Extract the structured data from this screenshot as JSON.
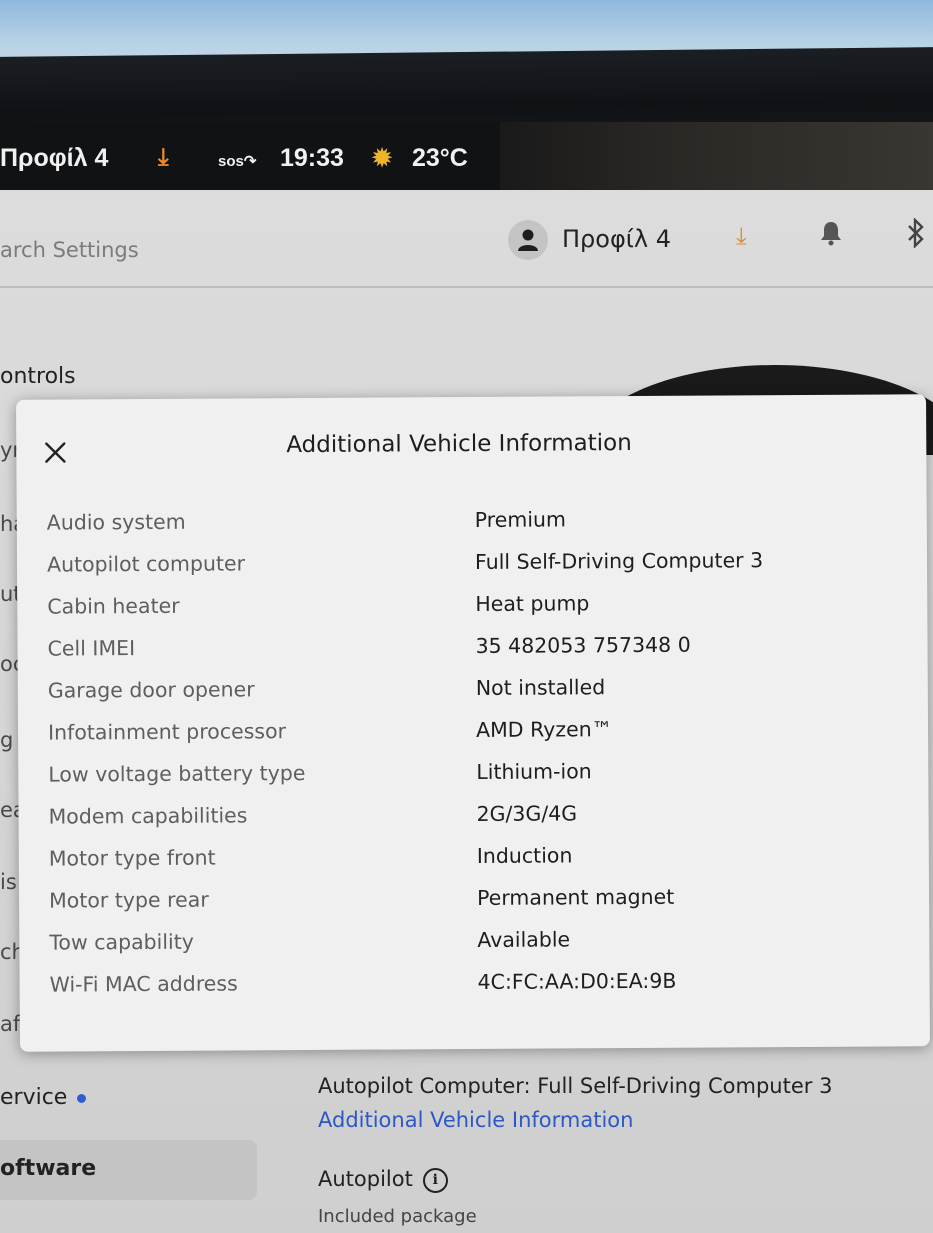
{
  "status_bar": {
    "profile": "Προφίλ 4",
    "sos": "sos",
    "time": "19:33",
    "temperature": "23°C"
  },
  "header": {
    "search_placeholder": "arch Settings",
    "profile_name": "Προφίλ 4"
  },
  "sidebar": {
    "items": [
      {
        "label": "ontrols"
      },
      {
        "label": "ervice"
      },
      {
        "label": "oftware"
      }
    ],
    "partial_labels": [
      "yr",
      "ha",
      "ut",
      "oc",
      "g",
      "ea",
      "is",
      "ch",
      "af"
    ]
  },
  "modal": {
    "title": "Additional Vehicle Information",
    "rows": [
      {
        "label": "Audio system",
        "value": "Premium"
      },
      {
        "label": "Autopilot computer",
        "value": "Full Self-Driving Computer 3"
      },
      {
        "label": "Cabin heater",
        "value": "Heat pump"
      },
      {
        "label": "Cell IMEI",
        "value": "35 482053 757348 0"
      },
      {
        "label": "Garage door opener",
        "value": "Not installed"
      },
      {
        "label": "Infotainment processor",
        "value": "AMD Ryzen™"
      },
      {
        "label": "Low voltage battery type",
        "value": "Lithium-ion"
      },
      {
        "label": "Modem capabilities",
        "value": "2G/3G/4G"
      },
      {
        "label": "Motor type front",
        "value": "Induction"
      },
      {
        "label": "Motor type rear",
        "value": "Permanent magnet"
      },
      {
        "label": "Tow capability",
        "value": "Available"
      },
      {
        "label": "Wi-Fi MAC address",
        "value": "4C:FC:AA:D0:EA:9B"
      }
    ]
  },
  "software": {
    "autopilot_computer_line": "Autopilot Computer: Full Self-Driving Computer 3",
    "additional_info_link": "Additional Vehicle Information",
    "autopilot_heading": "Autopilot",
    "autopilot_sub": "Included package"
  },
  "colors": {
    "accent_orange": "#f08a24",
    "link_blue": "#2c58c6",
    "service_dot": "#2d5fd0"
  },
  "icons": [
    "download-icon",
    "sos-icon",
    "sun-icon",
    "user-icon",
    "bell-icon",
    "bluetooth-icon",
    "close-icon",
    "info-icon"
  ]
}
